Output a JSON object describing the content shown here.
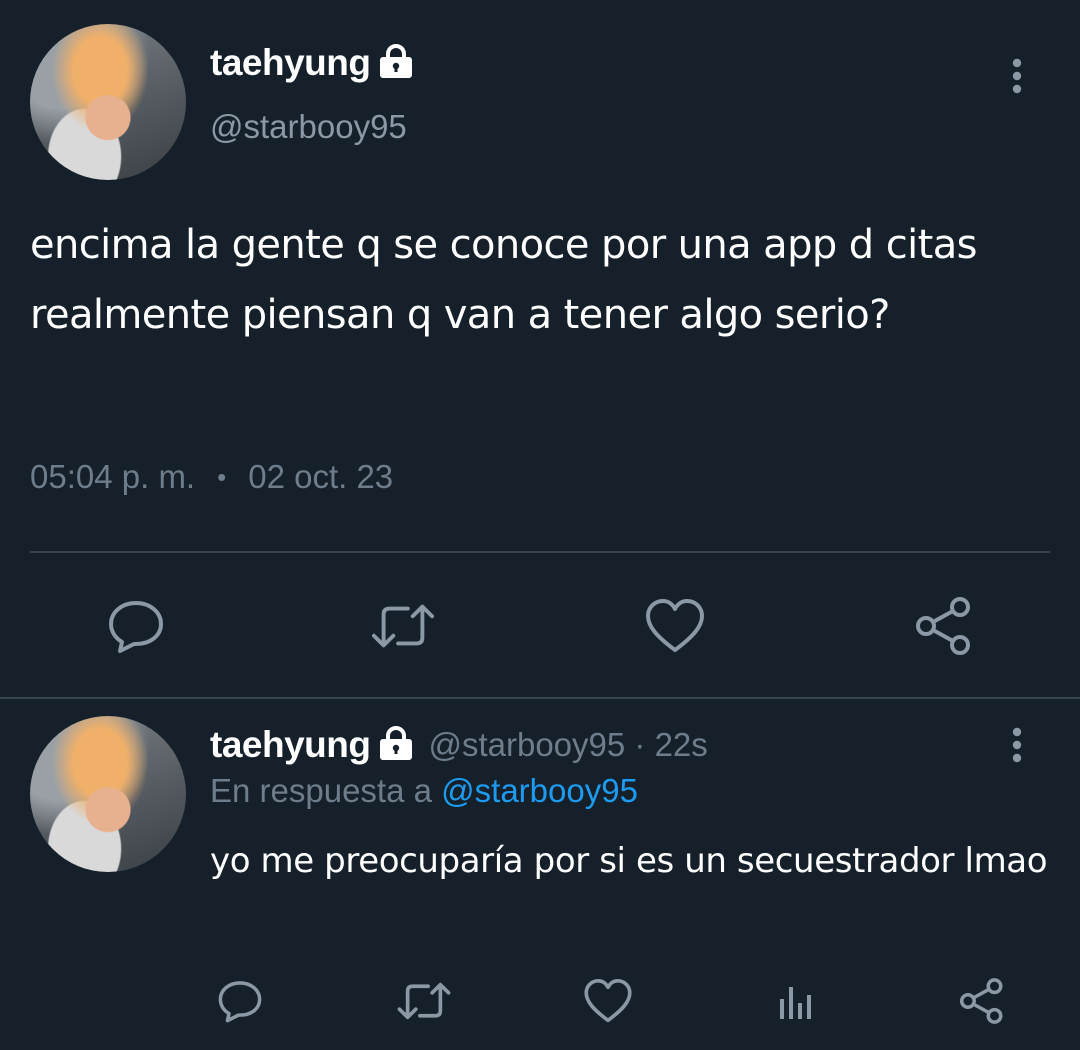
{
  "main_tweet": {
    "display_name": "taehyung",
    "handle": "@starbooy95",
    "text": "encima la gente q se conoce por una app d citas realmente piensan q van a tener algo serio?",
    "time": "05:04 p. m.",
    "separator": "•",
    "date": "02 oct. 23",
    "actions": [
      "reply-icon",
      "retweet-icon",
      "like-icon",
      "share-icon"
    ]
  },
  "reply_tweet": {
    "display_name": "taehyung",
    "handle_time": "@starbooy95 · 22s",
    "reply_prefix": "En respuesta a",
    "reply_mention": "@starbooy95",
    "text": "yo me preocuparía por si es un secuestrador lmao",
    "actions": [
      "reply-icon",
      "retweet-icon",
      "like-icon",
      "analytics-icon",
      "share-icon"
    ]
  },
  "colors": {
    "background": "#15202b",
    "text_primary": "#ffffff",
    "text_secondary": "#8b98a5",
    "divider": "#38444d",
    "link": "#1d9bf0",
    "icon": "#8b98a5"
  }
}
